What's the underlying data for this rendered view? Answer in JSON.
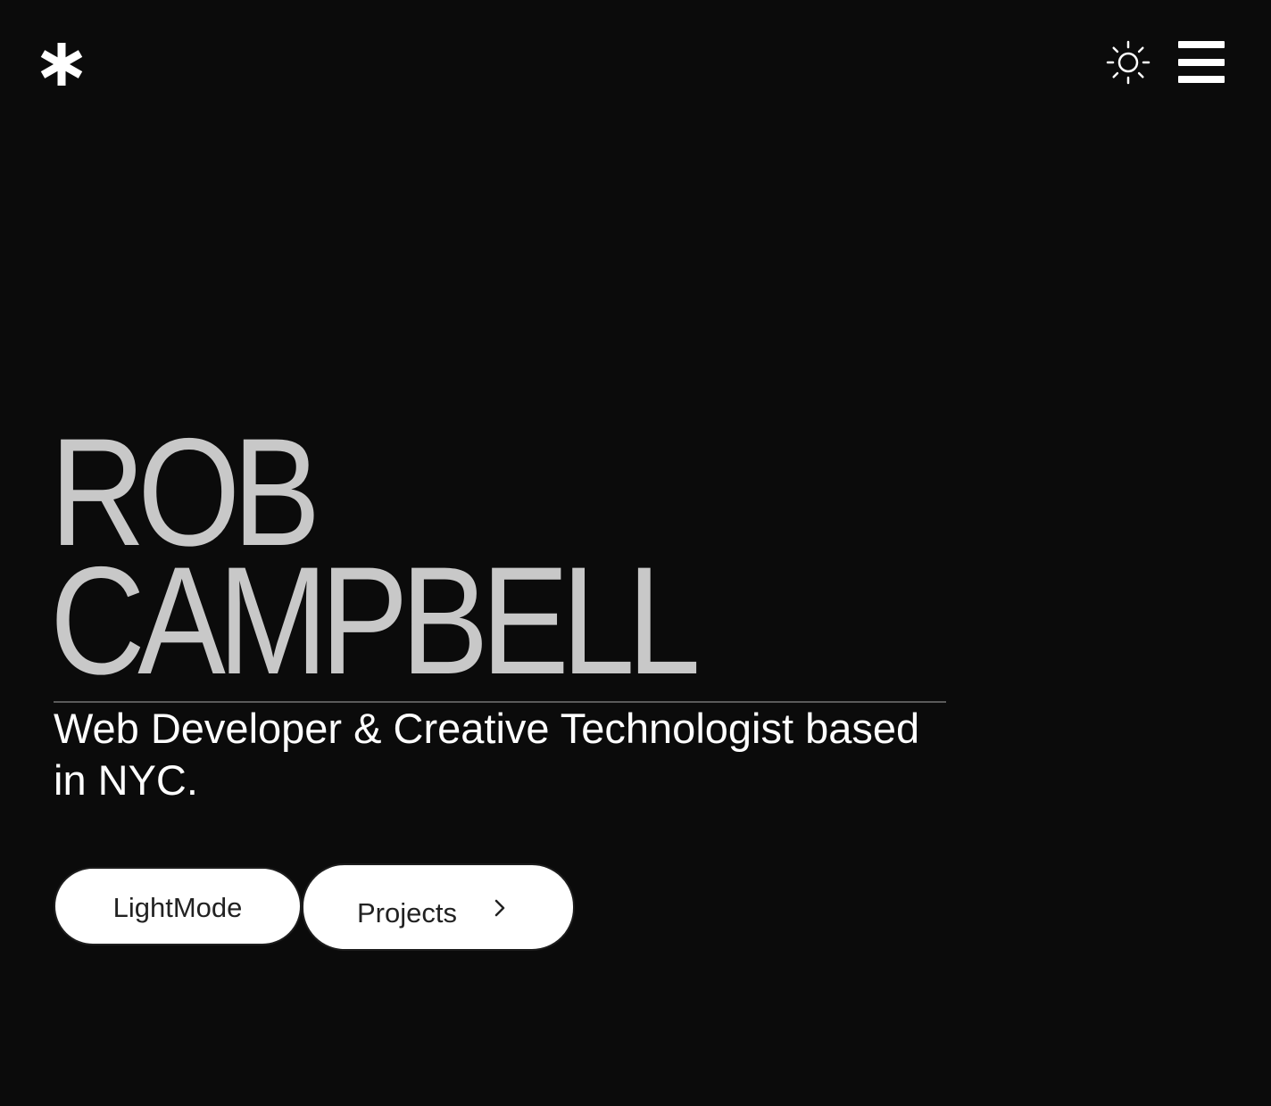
{
  "header": {
    "logo_icon": "asterisk-icon",
    "theme_toggle_icon": "sun-icon",
    "menu_icon": "hamburger-menu-icon"
  },
  "hero": {
    "name_line_1": "ROB",
    "name_line_2": "CAMPBELL",
    "tagline": "Web Developer & Creative Technologist based in NYC."
  },
  "actions": {
    "lightmode_label": "LightMode",
    "projects_label": "Projects",
    "projects_icon": "chevron-right-icon"
  },
  "colors": {
    "background": "#0b0b0b",
    "name_text": "#c8c8c8",
    "tagline_text": "#ffffff",
    "button_bg": "#ffffff",
    "button_text": "#222222"
  }
}
